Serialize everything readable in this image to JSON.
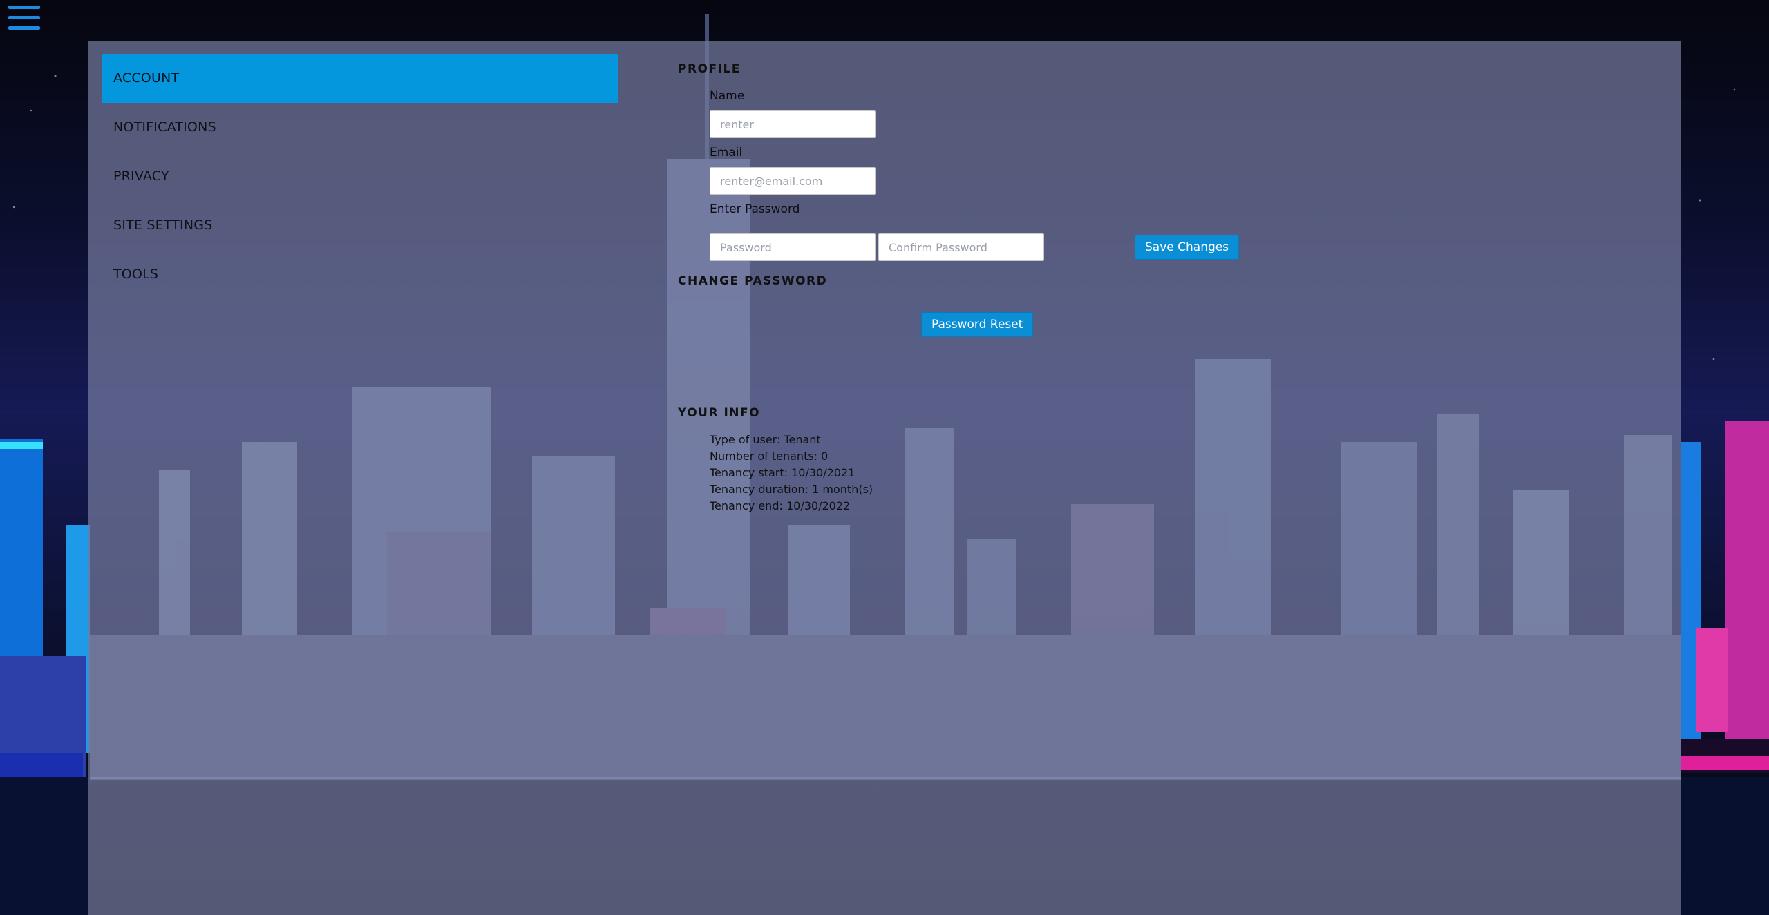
{
  "sidebar": {
    "items": [
      {
        "label": "ACCOUNT",
        "active": true
      },
      {
        "label": "NOTIFICATIONS",
        "active": false
      },
      {
        "label": "PRIVACY",
        "active": false
      },
      {
        "label": "SITE SETTINGS",
        "active": false
      },
      {
        "label": "TOOLS",
        "active": false
      }
    ]
  },
  "menu": {
    "icon": "hamburger-icon"
  },
  "profile": {
    "title": "PROFILE",
    "name_label": "Name",
    "name_placeholder": "renter",
    "email_label": "Email",
    "email_placeholder": "renter@email.com",
    "password_label": "Enter Password",
    "password_placeholder": "Password",
    "confirm_placeholder": "Confirm Password",
    "save_label": "Save Changes"
  },
  "change_password": {
    "title": "CHANGE PASSWORD",
    "reset_label": "Password Reset"
  },
  "your_info": {
    "title": "YOUR INFO",
    "lines": [
      "Type of user: Tenant",
      "Number of tenants: 0",
      "Tenancy start: 10/30/2021",
      "Tenancy duration: 1 month(s)",
      "Tenancy end: 10/30/2022"
    ]
  },
  "colors": {
    "accent": "#0597de",
    "button": "#0a8fd6",
    "panel": "#747a9e"
  }
}
